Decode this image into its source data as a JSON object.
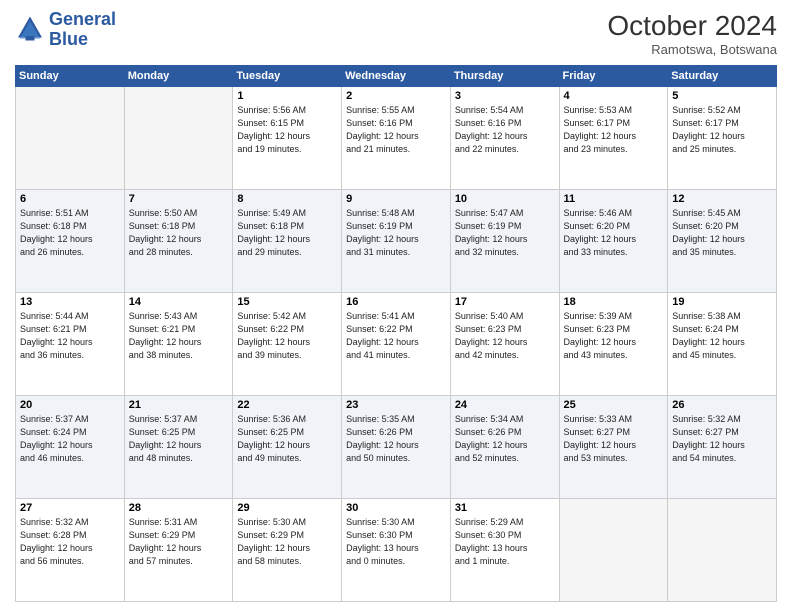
{
  "header": {
    "logo_line1": "General",
    "logo_line2": "Blue",
    "month": "October 2024",
    "location": "Ramotswa, Botswana"
  },
  "weekdays": [
    "Sunday",
    "Monday",
    "Tuesday",
    "Wednesday",
    "Thursday",
    "Friday",
    "Saturday"
  ],
  "weeks": [
    [
      {
        "day": "",
        "info": ""
      },
      {
        "day": "",
        "info": ""
      },
      {
        "day": "1",
        "info": "Sunrise: 5:56 AM\nSunset: 6:15 PM\nDaylight: 12 hours\nand 19 minutes."
      },
      {
        "day": "2",
        "info": "Sunrise: 5:55 AM\nSunset: 6:16 PM\nDaylight: 12 hours\nand 21 minutes."
      },
      {
        "day": "3",
        "info": "Sunrise: 5:54 AM\nSunset: 6:16 PM\nDaylight: 12 hours\nand 22 minutes."
      },
      {
        "day": "4",
        "info": "Sunrise: 5:53 AM\nSunset: 6:17 PM\nDaylight: 12 hours\nand 23 minutes."
      },
      {
        "day": "5",
        "info": "Sunrise: 5:52 AM\nSunset: 6:17 PM\nDaylight: 12 hours\nand 25 minutes."
      }
    ],
    [
      {
        "day": "6",
        "info": "Sunrise: 5:51 AM\nSunset: 6:18 PM\nDaylight: 12 hours\nand 26 minutes."
      },
      {
        "day": "7",
        "info": "Sunrise: 5:50 AM\nSunset: 6:18 PM\nDaylight: 12 hours\nand 28 minutes."
      },
      {
        "day": "8",
        "info": "Sunrise: 5:49 AM\nSunset: 6:18 PM\nDaylight: 12 hours\nand 29 minutes."
      },
      {
        "day": "9",
        "info": "Sunrise: 5:48 AM\nSunset: 6:19 PM\nDaylight: 12 hours\nand 31 minutes."
      },
      {
        "day": "10",
        "info": "Sunrise: 5:47 AM\nSunset: 6:19 PM\nDaylight: 12 hours\nand 32 minutes."
      },
      {
        "day": "11",
        "info": "Sunrise: 5:46 AM\nSunset: 6:20 PM\nDaylight: 12 hours\nand 33 minutes."
      },
      {
        "day": "12",
        "info": "Sunrise: 5:45 AM\nSunset: 6:20 PM\nDaylight: 12 hours\nand 35 minutes."
      }
    ],
    [
      {
        "day": "13",
        "info": "Sunrise: 5:44 AM\nSunset: 6:21 PM\nDaylight: 12 hours\nand 36 minutes."
      },
      {
        "day": "14",
        "info": "Sunrise: 5:43 AM\nSunset: 6:21 PM\nDaylight: 12 hours\nand 38 minutes."
      },
      {
        "day": "15",
        "info": "Sunrise: 5:42 AM\nSunset: 6:22 PM\nDaylight: 12 hours\nand 39 minutes."
      },
      {
        "day": "16",
        "info": "Sunrise: 5:41 AM\nSunset: 6:22 PM\nDaylight: 12 hours\nand 41 minutes."
      },
      {
        "day": "17",
        "info": "Sunrise: 5:40 AM\nSunset: 6:23 PM\nDaylight: 12 hours\nand 42 minutes."
      },
      {
        "day": "18",
        "info": "Sunrise: 5:39 AM\nSunset: 6:23 PM\nDaylight: 12 hours\nand 43 minutes."
      },
      {
        "day": "19",
        "info": "Sunrise: 5:38 AM\nSunset: 6:24 PM\nDaylight: 12 hours\nand 45 minutes."
      }
    ],
    [
      {
        "day": "20",
        "info": "Sunrise: 5:37 AM\nSunset: 6:24 PM\nDaylight: 12 hours\nand 46 minutes."
      },
      {
        "day": "21",
        "info": "Sunrise: 5:37 AM\nSunset: 6:25 PM\nDaylight: 12 hours\nand 48 minutes."
      },
      {
        "day": "22",
        "info": "Sunrise: 5:36 AM\nSunset: 6:25 PM\nDaylight: 12 hours\nand 49 minutes."
      },
      {
        "day": "23",
        "info": "Sunrise: 5:35 AM\nSunset: 6:26 PM\nDaylight: 12 hours\nand 50 minutes."
      },
      {
        "day": "24",
        "info": "Sunrise: 5:34 AM\nSunset: 6:26 PM\nDaylight: 12 hours\nand 52 minutes."
      },
      {
        "day": "25",
        "info": "Sunrise: 5:33 AM\nSunset: 6:27 PM\nDaylight: 12 hours\nand 53 minutes."
      },
      {
        "day": "26",
        "info": "Sunrise: 5:32 AM\nSunset: 6:27 PM\nDaylight: 12 hours\nand 54 minutes."
      }
    ],
    [
      {
        "day": "27",
        "info": "Sunrise: 5:32 AM\nSunset: 6:28 PM\nDaylight: 12 hours\nand 56 minutes."
      },
      {
        "day": "28",
        "info": "Sunrise: 5:31 AM\nSunset: 6:29 PM\nDaylight: 12 hours\nand 57 minutes."
      },
      {
        "day": "29",
        "info": "Sunrise: 5:30 AM\nSunset: 6:29 PM\nDaylight: 12 hours\nand 58 minutes."
      },
      {
        "day": "30",
        "info": "Sunrise: 5:30 AM\nSunset: 6:30 PM\nDaylight: 13 hours\nand 0 minutes."
      },
      {
        "day": "31",
        "info": "Sunrise: 5:29 AM\nSunset: 6:30 PM\nDaylight: 13 hours\nand 1 minute."
      },
      {
        "day": "",
        "info": ""
      },
      {
        "day": "",
        "info": ""
      }
    ]
  ]
}
